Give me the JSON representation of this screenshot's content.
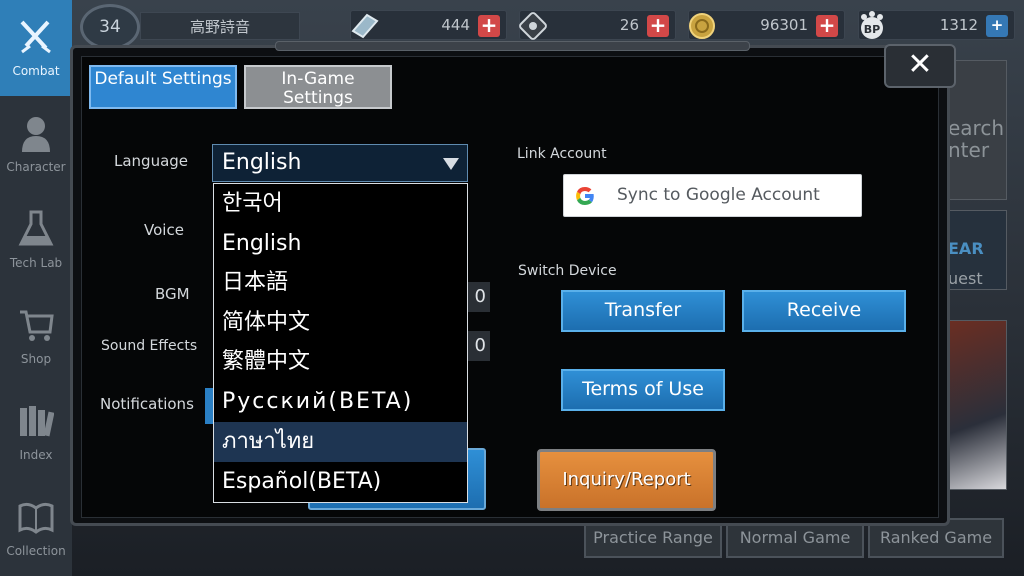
{
  "sidebar": {
    "items": [
      {
        "label": "Combat",
        "icon": "crossed-swords-icon",
        "active": true
      },
      {
        "label": "Character",
        "icon": "character-bust-icon",
        "active": false
      },
      {
        "label": "Tech Lab",
        "icon": "flask-icon",
        "active": false
      },
      {
        "label": "Shop",
        "icon": "shopping-cart-icon",
        "active": false
      },
      {
        "label": "Index",
        "icon": "books-icon",
        "active": false
      },
      {
        "label": "Collection",
        "icon": "open-book-icon",
        "active": false
      }
    ]
  },
  "topbar": {
    "level": "34",
    "player_name": "高野詩音",
    "resources": [
      {
        "icon": "crystal-icon",
        "value": "444",
        "action": "+"
      },
      {
        "icon": "ticket-icon",
        "value": "26",
        "action": "+"
      },
      {
        "icon": "gold-coin-icon",
        "value": "96301",
        "action": "+"
      },
      {
        "icon": "bp-paw-icon",
        "value": "1312",
        "action": "+"
      }
    ]
  },
  "background": {
    "right_texts": [
      "earch",
      "nter",
      "EAR",
      "uest"
    ],
    "bottom_tabs": [
      "Practice Range",
      "Normal Game",
      "Ranked Game"
    ]
  },
  "settings": {
    "tabs": [
      {
        "label": "Default Settings",
        "active": true
      },
      {
        "label": "In-Game Settings",
        "active": false
      }
    ],
    "close_label": "✕",
    "language_label": "Language",
    "language_value": "English",
    "language_options": [
      "한국어",
      "English",
      "日本語",
      "简体中文",
      "繁體中文",
      "Русский(BETA)",
      "ภาษาไทย",
      "Español(BETA)"
    ],
    "highlighted_option": "ภาษาไทย",
    "voice_label": "Voice",
    "bgm_label": "BGM",
    "bgm_value": "0",
    "sfx_label": "Sound Effects",
    "sfx_value": "0",
    "notifications_label": "Notifications",
    "link_account_label": "Link Account",
    "google_button": "Sync to Google Account",
    "switch_device_label": "Switch Device",
    "transfer_button": "Transfer",
    "receive_button": "Receive",
    "terms_button": "Terms of Use",
    "inquiry_button": "Inquiry/Report"
  },
  "colors": {
    "accent_blue": "#2f86d1",
    "inquiry_orange": "#e6903e",
    "plus_red": "#d24848"
  }
}
